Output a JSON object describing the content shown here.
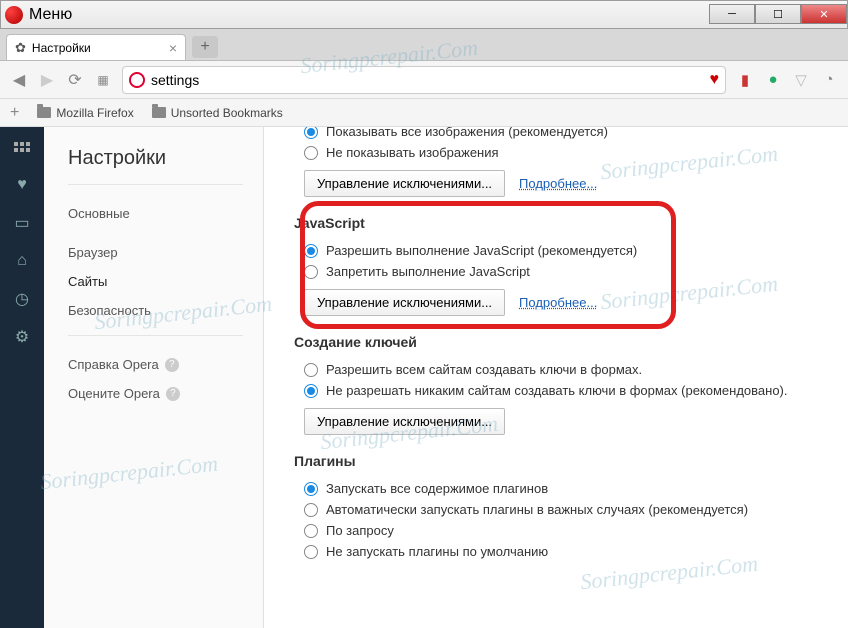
{
  "titlebar": {
    "menu": "Меню"
  },
  "tab": {
    "title": "Настройки"
  },
  "toolbar": {
    "url": "settings"
  },
  "bookmarks": {
    "item1": "Mozilla Firefox",
    "item2": "Unsorted Bookmarks"
  },
  "sidebar": {
    "title": "Настройки",
    "nav": {
      "basic": "Основные",
      "browser": "Браузер",
      "sites": "Сайты",
      "security": "Безопасность",
      "help": "Справка Opera",
      "rate": "Оцените Opera"
    }
  },
  "content": {
    "images": {
      "opt1_partial": "Показывать все изображения (рекомендуется)",
      "opt2": "Не показывать изображения",
      "manage": "Управление исключениями...",
      "more": "Подробнее..."
    },
    "javascript": {
      "title": "JavaScript",
      "opt1": "Разрешить выполнение JavaScript (рекомендуется)",
      "opt2": "Запретить выполнение JavaScript",
      "manage": "Управление исключениями...",
      "more": "Подробнее..."
    },
    "keys": {
      "title": "Создание ключей",
      "opt1": "Разрешить всем сайтам создавать ключи в формах.",
      "opt2": "Не разрешать никаким сайтам создавать ключи в формах (рекомендовано).",
      "manage": "Управление исключениями..."
    },
    "plugins": {
      "title": "Плагины",
      "opt1": "Запускать все содержимое плагинов",
      "opt2": "Автоматически запускать плагины в важных случаях (рекомендуется)",
      "opt3": "По запросу",
      "opt4": "Не запускать плагины по умолчанию"
    }
  },
  "watermark": "Soringpcrepair.Com"
}
